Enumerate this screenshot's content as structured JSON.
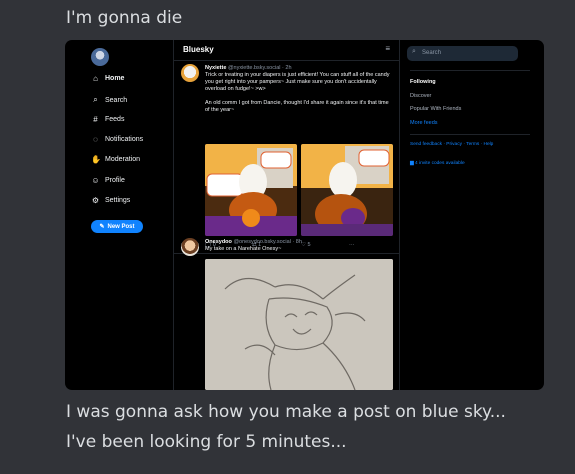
{
  "messages": [
    "I'm gonna die",
    "I was gonna ask how you make a post on blue sky...",
    "I've been looking for 5 minutes..."
  ],
  "bluesky": {
    "nav": {
      "items": [
        {
          "label": "Home",
          "icon": "home-icon"
        },
        {
          "label": "Search",
          "icon": "search-icon"
        },
        {
          "label": "Feeds",
          "icon": "hash-icon"
        },
        {
          "label": "Notifications",
          "icon": "bell-icon"
        },
        {
          "label": "Moderation",
          "icon": "hand-icon"
        },
        {
          "label": "Profile",
          "icon": "profile-icon"
        },
        {
          "label": "Settings",
          "icon": "gear-icon"
        }
      ],
      "new_post": "New Post"
    },
    "feed": {
      "title": "Bluesky",
      "posts": [
        {
          "name": "Nyxiette",
          "handle": "@nyxiette.bsky.social · 2h",
          "text": [
            "Trick or treating in your diapers is just efficient! You can stuff all of the candy you get right into your pampers~ Just make sure you don't accidentally overload on fudge!~ >w>",
            "An old comm I got from Dancie, thought I'd share it again since it's that time of the year~"
          ],
          "replies": "0",
          "reposts": "1",
          "likes": "5",
          "more": "···"
        },
        {
          "name": "Onesydoo",
          "handle": "@onesydoo.bsky.social · 8h",
          "text": [
            "My take on a Narehate Onesy~"
          ]
        }
      ]
    },
    "sidebar": {
      "search_placeholder": "Search",
      "links": [
        "Following",
        "Discover",
        "Popular With Friends",
        "More feeds"
      ],
      "footer": "Send feedback · Privacy · Terms · Help",
      "invites": "4 invite codes available"
    }
  }
}
